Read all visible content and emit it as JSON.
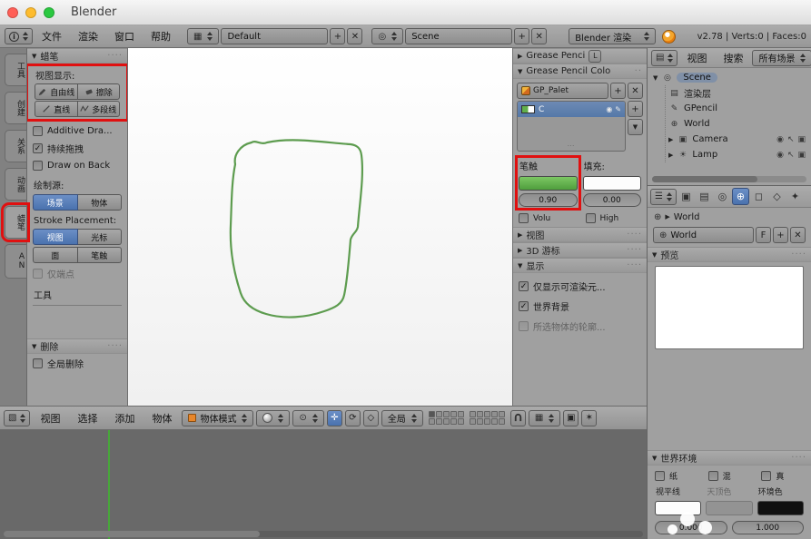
{
  "titlebar": {
    "title": "Blender"
  },
  "menubar": {
    "menus": {
      "file": "文件",
      "render": "渲染",
      "window": "窗口",
      "help": "帮助"
    },
    "layout_value": "Default",
    "scene_value": "Scene",
    "engine_value": "Blender 渲染",
    "stats": "v2.78 | Verts:0 | Faces:0"
  },
  "tabstrip": {
    "tabs": [
      "工具",
      "创建",
      "关系",
      "动画",
      "蜡笔",
      "AN"
    ]
  },
  "toolshelf": {
    "grease": {
      "title": "蜡笔",
      "view_display_label": "视图显示:",
      "btn_freehand": "自由线",
      "btn_erase": "擦除",
      "btn_line": "直线",
      "btn_poly": "多段线",
      "chk_additive": "Additive Dra...",
      "chk_continuous": "持续拖拽",
      "chk_drawback": "Draw on Back",
      "source_label": "绘制源:",
      "btn_scene": "场景",
      "btn_object": "物体",
      "placement_label": "Stroke Placement:",
      "btn_view": "视图",
      "btn_cursor": "光标",
      "btn_surface": "面",
      "btn_stroke": "笔触",
      "chk_endpoints": "仅端点",
      "tool_label": "工具"
    },
    "delete": {
      "title": "删除",
      "chk_global": "全局删除"
    }
  },
  "npanel": {
    "layers_title": "Grease Penci",
    "layers_badge": "L",
    "colors_title": "Grease Pencil Colo",
    "palette_name": "GP_Palet",
    "color_name": "C",
    "stroke_label": "笔触",
    "stroke_value": "0.90",
    "fill_label": "填充:",
    "fill_value": "0.00",
    "chk_volumetric": "Volu",
    "chk_high": "High",
    "view_title": "视图",
    "cursor_title": "3D 游标",
    "display_title": "显示",
    "chk_renderable": "仅显示可渲染元...",
    "chk_world_bg": "世界背景",
    "chk_outline": "所选物体的轮廓..."
  },
  "outliner": {
    "menu_view": "视图",
    "menu_search": "搜索",
    "scope": "所有场景",
    "rows": {
      "scene": "Scene",
      "renderlayers": "渲染层",
      "gpencil": "GPencil",
      "world": "World",
      "camera": "Camera",
      "lamp": "Lamp"
    }
  },
  "properties": {
    "breadcrumb": "World",
    "datablock_name": "World",
    "fake_user": "F",
    "preview_title": "预览",
    "world_title": "世界环境",
    "chk_paper": "纸",
    "chk_blend": "混",
    "chk_real": "真",
    "horizon_label": "视平线",
    "zenith_label": "天顶色",
    "ambient_label": "环境色",
    "exposure_value": "0.000",
    "range_value": "1.000"
  },
  "view3d": {
    "menus": {
      "view": "视图",
      "select": "选择",
      "add": "添加",
      "object": "物体"
    },
    "mode_value": "物体模式",
    "orientation_value": "全局"
  },
  "colors": {
    "accent_blue": "#4f76b3",
    "highlight_red": "#e01010",
    "stroke_green": "#5d9c4f",
    "stroke_swatch": "#62b04c"
  }
}
